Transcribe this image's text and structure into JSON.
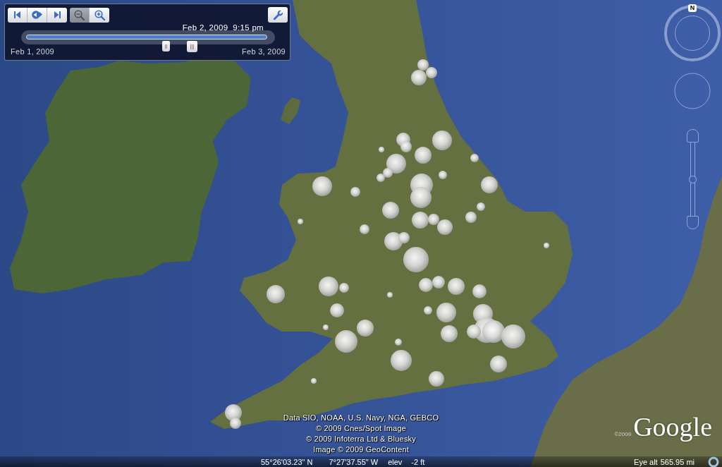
{
  "time_slider": {
    "playback_buttons": [
      {
        "kind": "skip_back",
        "disabled": false
      },
      {
        "kind": "play",
        "disabled": false
      },
      {
        "kind": "skip_forward",
        "disabled": false
      }
    ],
    "zoom_buttons": [
      {
        "kind": "zoom_out",
        "disabled": true
      },
      {
        "kind": "zoom_in",
        "disabled": false
      }
    ],
    "current_time": "Feb 2, 2009  9:15 pm",
    "handles": [
      {
        "level": 0.58
      },
      {
        "level": 0.69
      }
    ],
    "range_start": "Feb 1, 2009",
    "range_end": "Feb 3, 2009"
  },
  "navigation": {
    "compass_label": "N",
    "zoom_slider": {
      "level": 0.5
    }
  },
  "attribution": [
    "Data SIO, NOAA, U.S. Navy, NGA, GEBCO",
    "© 2009 Cnes/Spot Image",
    "© 2009 Infoterra Ltd & Bluesky",
    "Image © 2009 GeoContent"
  ],
  "logo": {
    "copyright": "©2009",
    "text": "Google"
  },
  "status_bar": {
    "latitude": "55°26'03.23\" N",
    "longitude": "7°27'37.55\" W",
    "elevation_label": "elev",
    "elevation": "-2 ft",
    "eye_alt_label": "Eye alt",
    "eye_alt": "565.95 mi"
  }
}
